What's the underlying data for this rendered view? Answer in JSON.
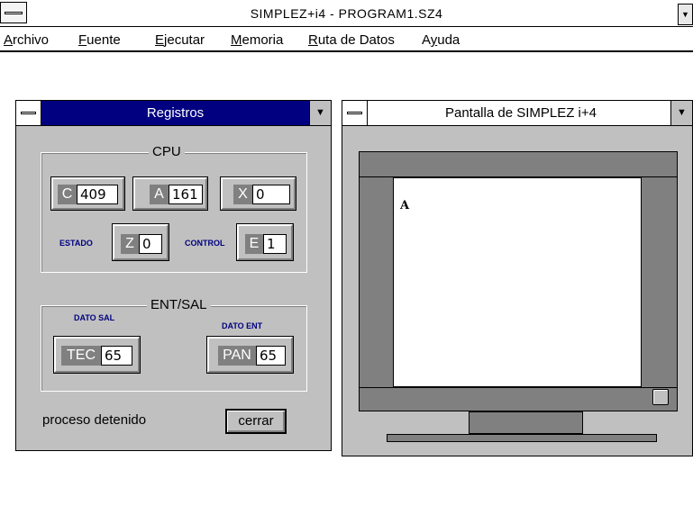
{
  "app": {
    "title": "SIMPLEZ+i4 - PROGRAM1.SZ4"
  },
  "menu": [
    {
      "key": "A",
      "rest": "rchivo"
    },
    {
      "key": "F",
      "rest": "uente"
    },
    {
      "key": "E",
      "rest": "jecutar"
    },
    {
      "key": "M",
      "rest": "emoria"
    },
    {
      "key": "R",
      "rest": "uta de Datos"
    },
    {
      "key": "",
      "pre": "A",
      "key2": "y",
      "rest": "uda"
    }
  ],
  "registros": {
    "title": "Registros",
    "cpu_label": "CPU",
    "c": {
      "tag": "C",
      "value": "409"
    },
    "a": {
      "tag": "A",
      "value": "161"
    },
    "x": {
      "tag": "X",
      "value": "0"
    },
    "estado_label": "ESTADO",
    "z": {
      "tag": "Z",
      "value": "0"
    },
    "control_label": "CONTROL",
    "e": {
      "tag": "E",
      "value": "1"
    },
    "entsal_label": "ENT/SAL",
    "dato_sal_label": "DATO SAL",
    "dato_ent_label": "DATO ENT",
    "tec": {
      "tag": "TEC",
      "value": "65"
    },
    "pan": {
      "tag": "PAN",
      "value": "65"
    },
    "status": "proceso detenido",
    "cerrar_label": "cerrar"
  },
  "pantalla": {
    "title": "Pantalla de SIMPLEZ i+4",
    "content": "A"
  },
  "colors": {
    "active_title": "#000080",
    "face": "#c0c0c0",
    "shadow": "#808080"
  }
}
